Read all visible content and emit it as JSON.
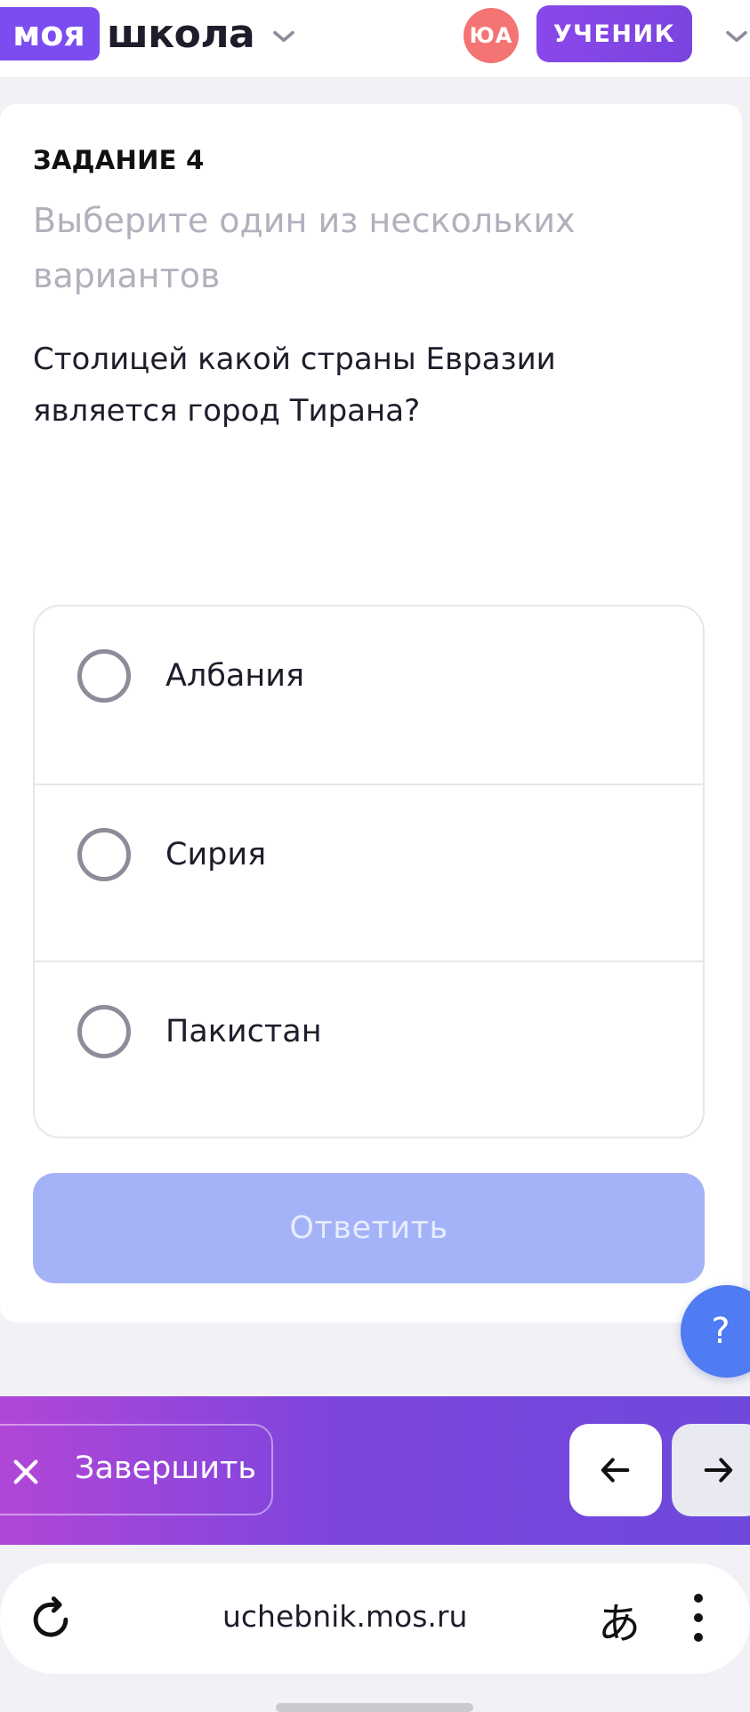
{
  "header": {
    "logo_part1": "моя",
    "logo_part2": "школа",
    "avatar_initials": "ЮА",
    "role_label": "УЧЕНИК",
    "colors": {
      "logo_bg": "#7b4df0",
      "avatar_bg": "#f47373",
      "role_bg": "#8a47ea"
    },
    "icons": [
      "chevron-down-icon"
    ]
  },
  "task": {
    "number_label": "ЗАДАНИЕ 4",
    "hint": "Выберите один из нескольких вариантов",
    "question": "Столицей какой страны Евразии является город Тирана?",
    "options": [
      {
        "label": "Албания",
        "selected": false
      },
      {
        "label": "Сирия",
        "selected": false
      },
      {
        "label": "Пакистан",
        "selected": false
      }
    ],
    "answer_button": "Ответить",
    "answer_button_state": "disabled"
  },
  "help_button_label": "?",
  "bottom_bar": {
    "finish_label": "Завершить",
    "icons": [
      "close-icon",
      "arrow-left-icon",
      "arrow-right-icon"
    ]
  },
  "browser": {
    "url": "uchebnik.mos.ru",
    "translate_glyph": "あ",
    "icons": [
      "reload-icon",
      "translate-icon",
      "more-vertical-icon"
    ]
  }
}
